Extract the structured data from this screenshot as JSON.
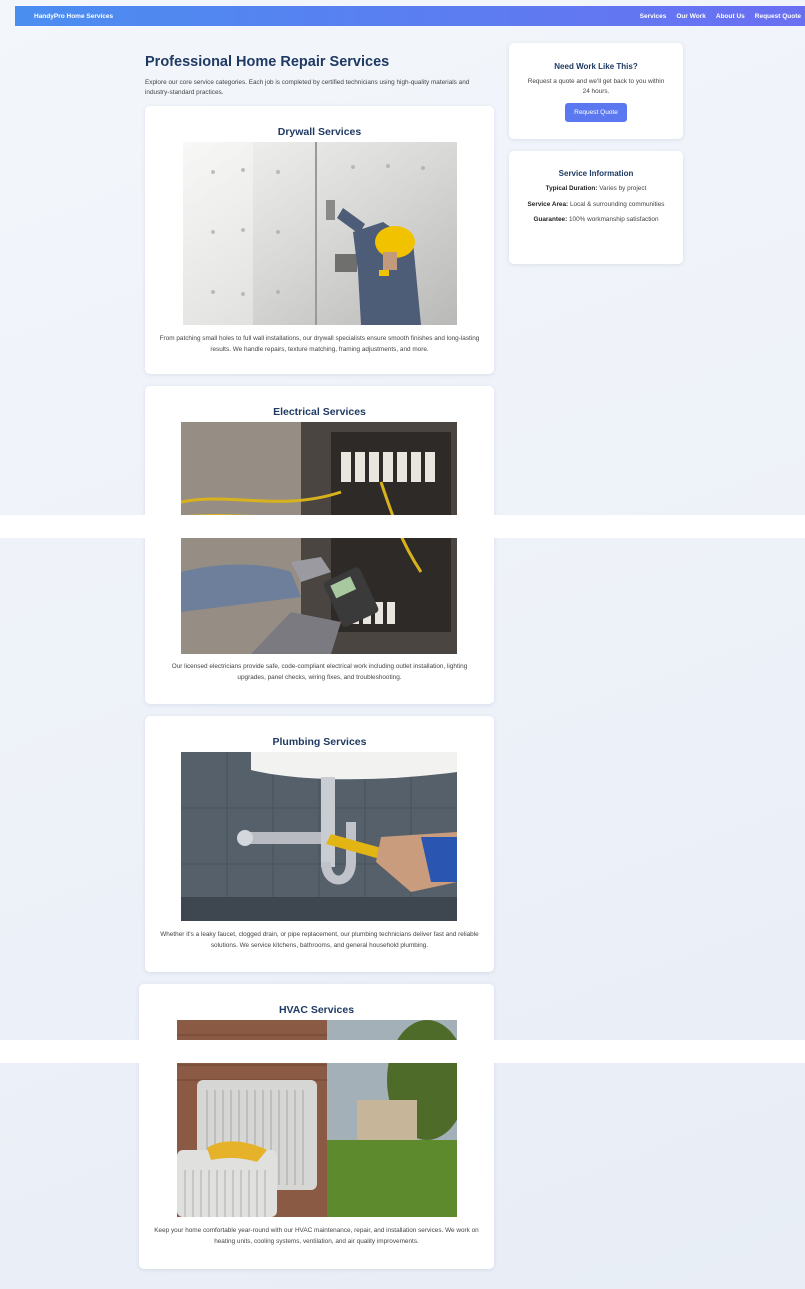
{
  "nav": {
    "brand": "HandyPro Home Services",
    "links": [
      "Services",
      "Our Work",
      "About Us",
      "Request Quote"
    ]
  },
  "intro": {
    "title": "Professional Home Repair Services",
    "text": "Explore our core service categories. Each job is completed by certified technicians using high-quality materials and industry-standard practices."
  },
  "services": [
    {
      "title": "Drywall Services",
      "text": "From patching small holes to full wall installations, our drywall specialists ensure smooth finishes and long-lasting results. We handle repairs, texture matching, framing adjustments, and more."
    },
    {
      "title": "Electrical Services",
      "text": "Our licensed electricians provide safe, code-compliant electrical work including outlet installation, lighting upgrades, panel checks, wiring fixes, and troubleshooting."
    },
    {
      "title": "Plumbing Services",
      "text": "Whether it's a leaky faucet, clogged drain, or pipe replacement, our plumbing technicians deliver fast and reliable solutions. We service kitchens, bathrooms, and general household plumbing."
    },
    {
      "title": "HVAC Services",
      "text": "Keep your home comfortable year-round with our HVAC maintenance, repair, and installation services. We work on heating units, cooling systems, ventilation, and air quality improvements."
    }
  ],
  "quote_box": {
    "title": "Need Work Like This?",
    "text": "Request a quote and we'll get back to you within 24 hours.",
    "button": "Request Quote"
  },
  "info_box": {
    "title": "Service Information",
    "duration_label": "Typical Duration:",
    "duration_value": "Varies by project",
    "area_label": "Service Area:",
    "area_value": "Local & surrounding communities",
    "guarantee_label": "Guarantee:",
    "guarantee_value": "100% workmanship satisfaction"
  }
}
